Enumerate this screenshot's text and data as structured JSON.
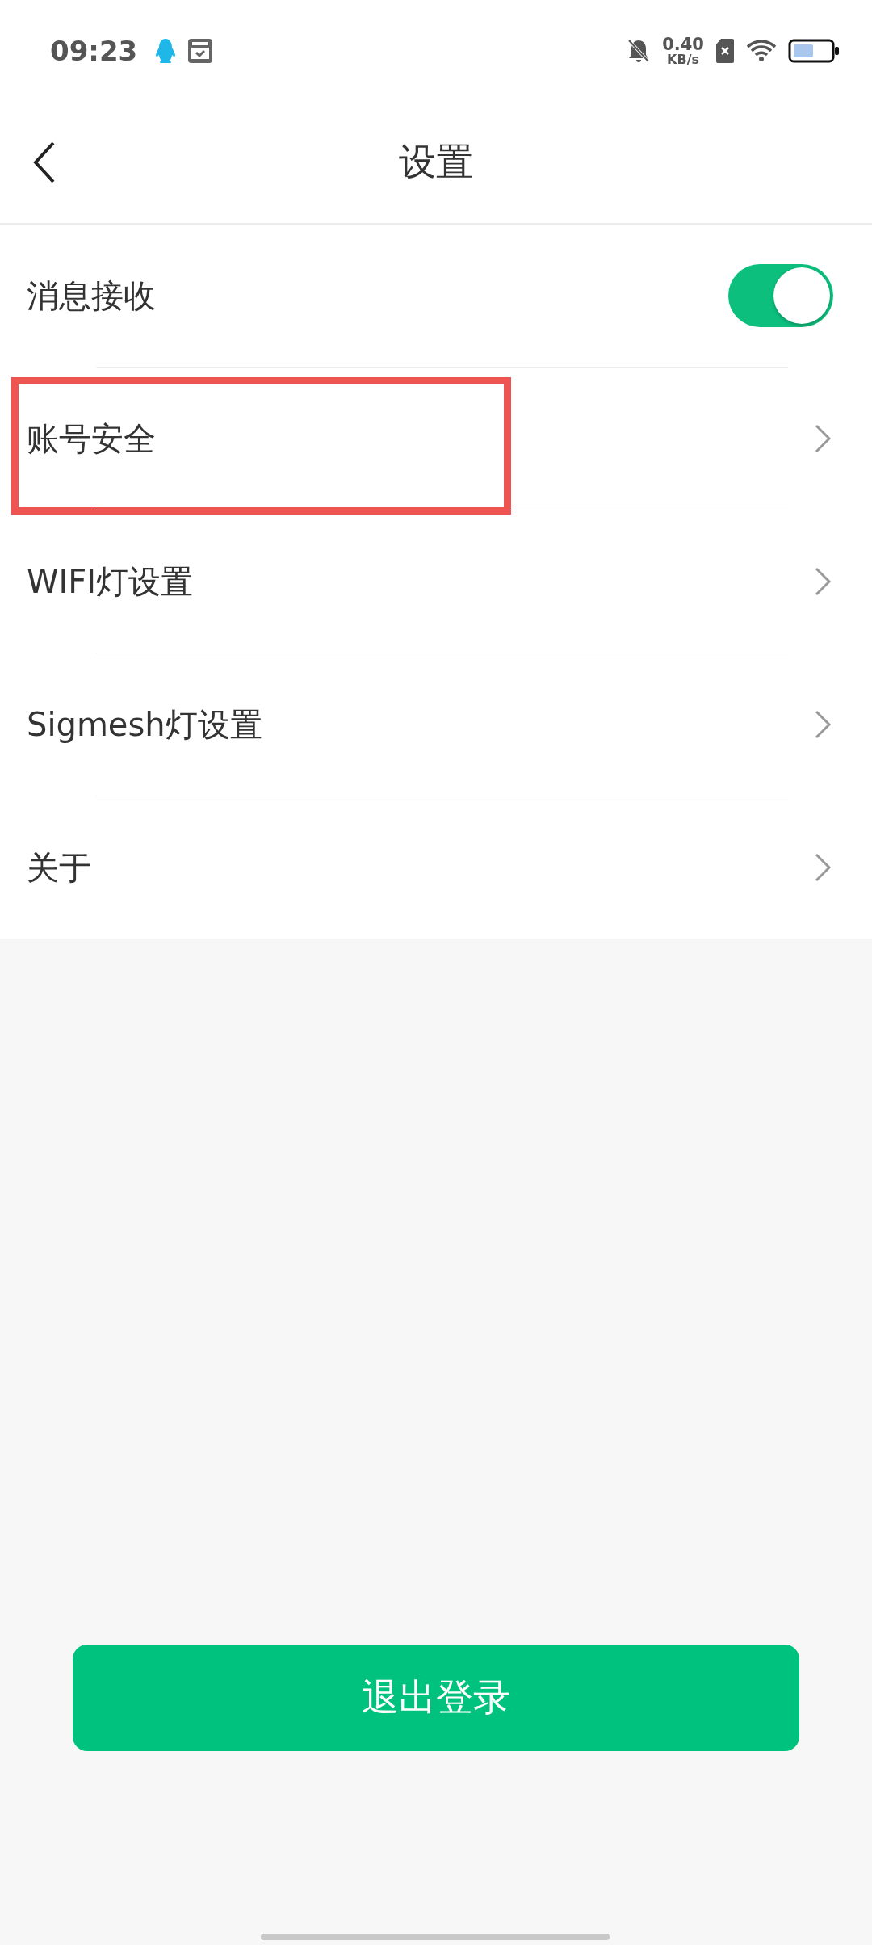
{
  "status_bar": {
    "time": "09:23",
    "speed_value": "0.40",
    "speed_unit": "KB/s"
  },
  "header": {
    "title": "设置"
  },
  "settings": [
    {
      "label": "消息接收",
      "kind": "toggle",
      "on": true,
      "highlighted": false
    },
    {
      "label": "账号安全",
      "kind": "link",
      "highlighted": true
    },
    {
      "label": "WIFI灯设置",
      "kind": "link",
      "highlighted": false
    },
    {
      "label": "Sigmesh灯设置",
      "kind": "link",
      "highlighted": false
    },
    {
      "label": "关于",
      "kind": "link",
      "highlighted": false
    }
  ],
  "logout_button": {
    "label": "退出登录"
  }
}
